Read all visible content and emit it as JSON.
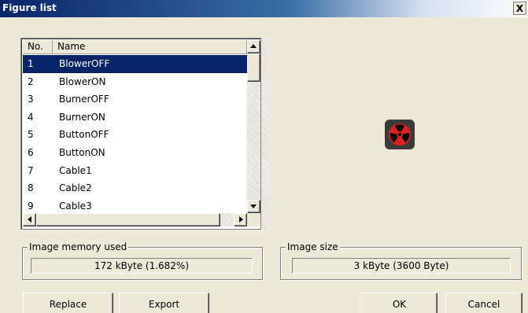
{
  "window": {
    "title": "Figure list",
    "close_label": "X"
  },
  "list": {
    "columns": [
      "No.",
      "Name"
    ],
    "rows": [
      {
        "no": "1",
        "name": "BlowerOFF",
        "selected": true
      },
      {
        "no": "2",
        "name": "BlowerON",
        "selected": false
      },
      {
        "no": "3",
        "name": "BurnerOFF",
        "selected": false
      },
      {
        "no": "4",
        "name": "BurnerON",
        "selected": false
      },
      {
        "no": "5",
        "name": "ButtonOFF",
        "selected": false
      },
      {
        "no": "6",
        "name": "ButtonON",
        "selected": false
      },
      {
        "no": "7",
        "name": "Cable1",
        "selected": false
      },
      {
        "no": "8",
        "name": "Cable2",
        "selected": false
      },
      {
        "no": "9",
        "name": "Cable3",
        "selected": false
      }
    ]
  },
  "preview": {
    "icon": "blower-off-icon",
    "icon_colors": {
      "background": "#3a3a3a",
      "blades": "#e02020",
      "hub": "#000000"
    }
  },
  "memory": {
    "label": "Image memory used",
    "value": "172 kByte (1.682%)"
  },
  "size": {
    "label": "Image size",
    "value": "3 kByte (3600 Byte)"
  },
  "buttons": {
    "replace": "Replace",
    "export": "Export",
    "ok": "OK",
    "cancel": "Cancel"
  },
  "colors": {
    "selection": "#0a246a",
    "title_bar": "#0a246a",
    "dialog": "#ece9d8"
  }
}
